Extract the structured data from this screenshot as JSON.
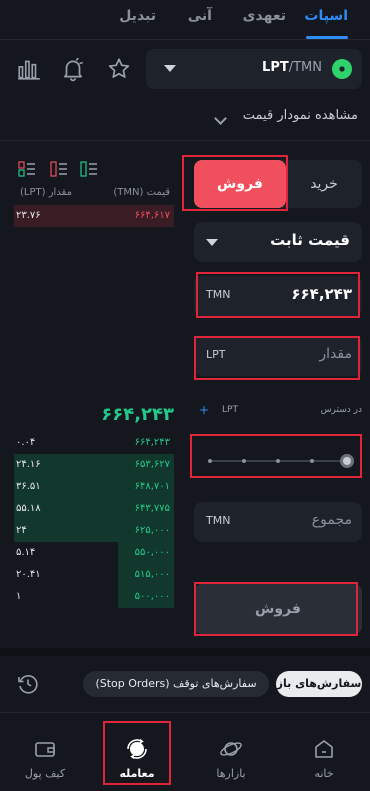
{
  "tabs": [
    {
      "label": "اسپات",
      "active": true
    },
    {
      "label": "تعهدی",
      "active": false
    },
    {
      "label": "آنی",
      "active": false
    },
    {
      "label": "تبدیل",
      "active": false
    }
  ],
  "market": {
    "base": "LPT",
    "quote": "/TMN",
    "icon": "livepeer-icon"
  },
  "chart_toggle_label": "مشاهده نمودار قیمت",
  "orderbook": {
    "header_price": "قیمت (TMN)",
    "header_amount": "مقدار (LPT)",
    "asks": [
      {
        "price": "۶۶۴,۶۱۷",
        "amount": "۲۳.۷۶",
        "depth": 1.0
      }
    ],
    "last_price": "۶۶۴,۲۴۳",
    "bids": [
      {
        "price": "۶۶۴,۲۴۳",
        "amount": "۰.۰۴",
        "depth": 0.0
      },
      {
        "price": "۶۵۳,۶۲۷",
        "amount": "۲۴.۱۶",
        "depth": 1.0
      },
      {
        "price": "۶۴۸,۷۰۱",
        "amount": "۳۶.۵۱",
        "depth": 1.0
      },
      {
        "price": "۶۴۳,۷۷۵",
        "amount": "۵۵.۱۸",
        "depth": 1.0
      },
      {
        "price": "۶۲۵,۰۰۰",
        "amount": "۲۴",
        "depth": 1.0
      },
      {
        "price": "۵۵۰,۰۰۰",
        "amount": "۵.۱۴",
        "depth": 0.35
      },
      {
        "price": "۵۱۵,۰۰۰",
        "amount": "۲۰.۴۱",
        "depth": 0.35
      },
      {
        "price": "۵۰۰,۰۰۰",
        "amount": "۱",
        "depth": 0.35
      }
    ]
  },
  "form": {
    "buy_label": "خرید",
    "sell_label": "فروش",
    "order_type": "قیمت ثابت",
    "price_unit": "TMN",
    "price_value": "۶۶۴,۲۴۳",
    "amount_placeholder": "مقدار",
    "amount_unit": "LPT",
    "available_label": "در دسترس",
    "available_unit": "LPT",
    "slider_percent": 100,
    "total_placeholder": "مجموع",
    "total_unit": "TMN",
    "submit_label": "فروش"
  },
  "orders": {
    "open_label": "سفارش‌های باز",
    "stop_label": "سفارش‌های توقف (Stop Orders)"
  },
  "nav": [
    {
      "label": "خانه",
      "icon": "home-icon",
      "active": false
    },
    {
      "label": "بازارها",
      "icon": "planet-icon",
      "active": false
    },
    {
      "label": "معامله",
      "icon": "trade-icon",
      "active": true
    },
    {
      "label": "کیف پول",
      "icon": "wallet-icon",
      "active": false
    }
  ],
  "colors": {
    "background": "#14171e",
    "accent": "#2f8cf6",
    "sell": "#f0505e",
    "buy": "#23c98a",
    "highlight": "#e0243a"
  }
}
